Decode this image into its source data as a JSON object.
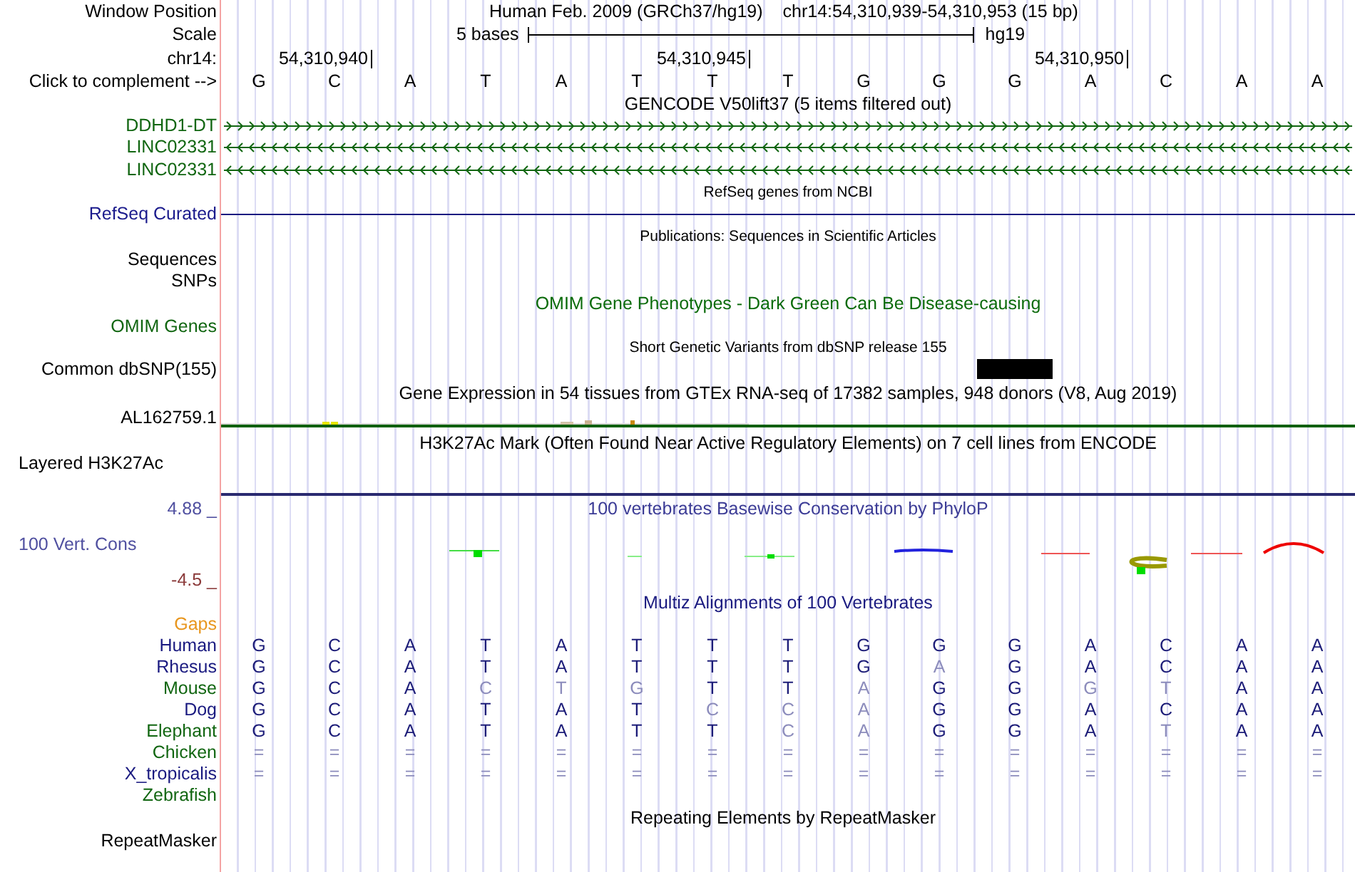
{
  "position": {
    "label": "Window Position",
    "assembly": "Human Feb. 2009 (GRCh37/hg19)",
    "range": "chr14:54,310,939-54,310,953 (15 bp)"
  },
  "scale": {
    "label": "Scale",
    "span": "5 bases",
    "genome": "hg19"
  },
  "coordinates": {
    "label": "chr14:",
    "ticks": [
      "54,310,940",
      "54,310,945",
      "54,310,950"
    ]
  },
  "complement": {
    "label": "Click to complement -->",
    "bases": [
      "G",
      "C",
      "A",
      "T",
      "A",
      "T",
      "T",
      "T",
      "G",
      "G",
      "G",
      "A",
      "C",
      "A",
      "A"
    ]
  },
  "tracks": [
    {
      "kind": "genes",
      "title": "GENCODE V50lift37 (5 items filtered out)",
      "items": [
        {
          "name": "DDHD1-DT",
          "reverse": false
        },
        {
          "name": "LINC02331",
          "reverse": true
        },
        {
          "name": "LINC02331",
          "reverse": true
        }
      ]
    },
    {
      "kind": "refseq",
      "title": "RefSeq genes from NCBI",
      "label": "RefSeq Curated"
    },
    {
      "kind": "publications",
      "title": "Publications: Sequences in Scientific Articles",
      "labels": [
        "Sequences",
        "SNPs"
      ]
    },
    {
      "kind": "omim",
      "title": "OMIM Gene Phenotypes - Dark Green Can Be Disease-causing",
      "label": "OMIM Genes"
    },
    {
      "kind": "dbsnp",
      "title": "Short Genetic Variants from dbSNP release 155",
      "label": "Common dbSNP(155)"
    },
    {
      "kind": "gtex",
      "title": "Gene Expression in 54 tissues from GTEx RNA-seq of 17382 samples, 948 donors (V8, Aug 2019)",
      "label": "AL162759.1"
    },
    {
      "kind": "h3k27ac",
      "title": "H3K27Ac Mark (Often Found Near Active Regulatory Elements) on 7 cell lines from ENCODE",
      "label": "Layered H3K27Ac"
    },
    {
      "kind": "conservation",
      "title": "100 vertebrates Basewise Conservation by PhyloP",
      "label": "100 Vert. Cons",
      "max_label": "4.88 _",
      "min_label": "-4.5 _"
    },
    {
      "kind": "multiz",
      "title": "Multiz Alignments of 100 Vertebrates",
      "gaps_label": "Gaps",
      "species": [
        {
          "name": "Human",
          "color": "#1a1a80",
          "bases": [
            "G",
            "C",
            "A",
            "T",
            "A",
            "T",
            "T",
            "T",
            "G",
            "G",
            "G",
            "A",
            "C",
            "A",
            "A"
          ]
        },
        {
          "name": "Rhesus",
          "color": "#1a1a80",
          "bases": [
            "G",
            "C",
            "A",
            "T",
            "A",
            "T",
            "T",
            "T",
            "G",
            "A",
            "G",
            "A",
            "C",
            "A",
            "A"
          ]
        },
        {
          "name": "Mouse",
          "color": "#116611",
          "bases": [
            "G",
            "C",
            "A",
            "C",
            "T",
            "G",
            "T",
            "T",
            "A",
            "G",
            "G",
            "G",
            "T",
            "A",
            "A"
          ]
        },
        {
          "name": "Dog",
          "color": "#1a1a80",
          "bases": [
            "G",
            "C",
            "A",
            "T",
            "A",
            "T",
            "C",
            "C",
            "A",
            "G",
            "G",
            "A",
            "C",
            "A",
            "A"
          ]
        },
        {
          "name": "Elephant",
          "color": "#116611",
          "bases": [
            "G",
            "C",
            "A",
            "T",
            "A",
            "T",
            "T",
            "C",
            "A",
            "G",
            "G",
            "A",
            "T",
            "A",
            "A"
          ]
        },
        {
          "name": "Chicken",
          "color": "#116611",
          "bases": [
            "=",
            "=",
            "=",
            "=",
            "=",
            "=",
            "=",
            "=",
            "=",
            "=",
            "=",
            "=",
            "=",
            "=",
            "="
          ]
        },
        {
          "name": "X_tropicalis",
          "color": "#1a1a80",
          "bases": [
            "=",
            "=",
            "=",
            "=",
            "=",
            "=",
            "=",
            "=",
            "=",
            "=",
            "=",
            "=",
            "=",
            "=",
            "="
          ]
        },
        {
          "name": "Zebrafish",
          "color": "#116611"
        }
      ]
    },
    {
      "kind": "repeatmasker",
      "title": "Repeating Elements by RepeatMasker",
      "label": "RepeatMasker"
    }
  ]
}
